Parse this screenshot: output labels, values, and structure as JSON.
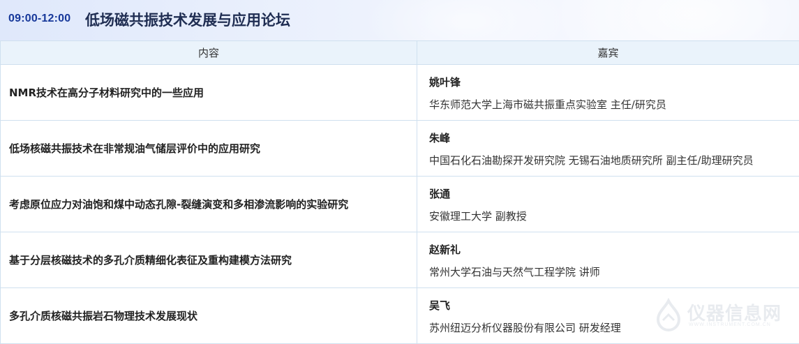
{
  "header": {
    "time": "09:00-12:00",
    "title": "低场磁共振技术发展与应用论坛"
  },
  "table": {
    "headers": [
      "内容",
      "嘉宾"
    ],
    "rows": [
      {
        "content": "NMR技术在高分子材料研究中的一些应用",
        "guest_name": "姚叶锋",
        "guest_affiliation": "华东师范大学上海市磁共振重点实验室 主任/研究员"
      },
      {
        "content": "低场核磁共振技术在非常规油气储层评价中的应用研究",
        "guest_name": "朱峰",
        "guest_affiliation": "中国石化石油勘探开发研究院 无锡石油地质研究所 副主任/助理研究员"
      },
      {
        "content": "考虑原位应力对油饱和煤中动态孔隙-裂缝演变和多相渗流影响的实验研究",
        "guest_name": "张通",
        "guest_affiliation": "安徽理工大学 副教授"
      },
      {
        "content": "基于分层核磁技术的多孔介质精细化表征及重构建模方法研究",
        "guest_name": "赵新礼",
        "guest_affiliation": "常州大学石油与天然气工程学院 讲师"
      },
      {
        "content": "多孔介质核磁共振岩石物理技术发展现状",
        "guest_name": "吴飞",
        "guest_affiliation": "苏州纽迈分析仪器股份有限公司 研发经理"
      }
    ]
  },
  "watermark": {
    "text": "仪器信息网",
    "subtext": "WWW.INSTRUMENT.COM.CN"
  }
}
